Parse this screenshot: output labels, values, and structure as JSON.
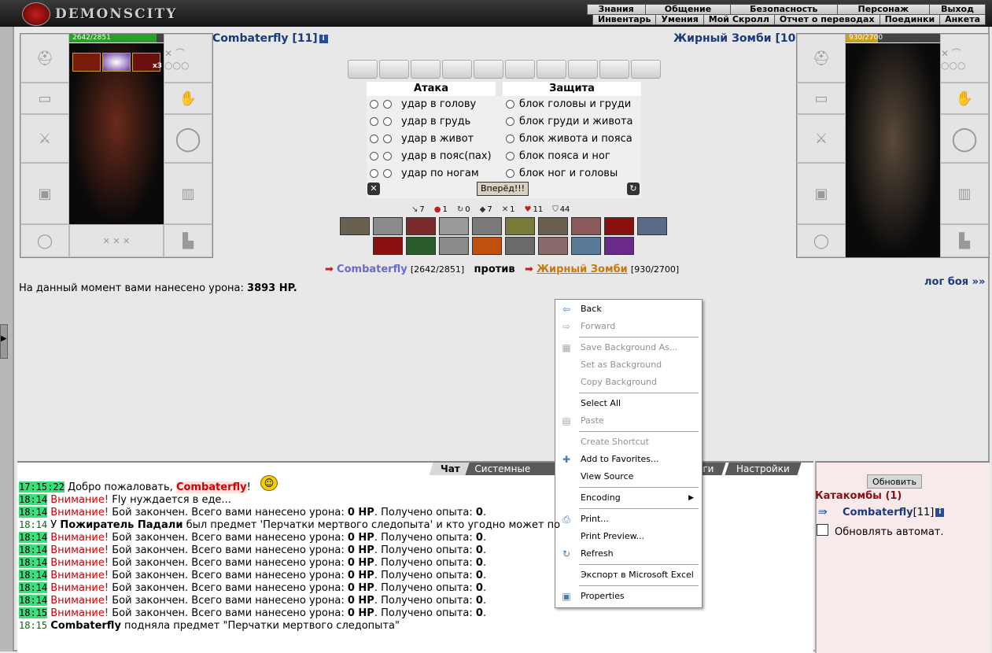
{
  "topbar": {
    "logo_text": "DEMONSCITY",
    "menu_top": [
      "Знания",
      "Общение",
      "Безопасность",
      "Персонаж",
      "Выход"
    ],
    "menu_bottom": [
      "Инвентарь",
      "Умения",
      "Мой Скролл",
      "Отчет о переводах",
      "Поединки",
      "Анкета"
    ]
  },
  "player": {
    "name": "Combaterfly [11]",
    "hp": "2642/2851",
    "hp_fraction": 0.927,
    "buff_count": "x3"
  },
  "enemy": {
    "name": "Жирный Зомби [10]",
    "hp": "930/2700",
    "hp_fraction": 0.344
  },
  "combat": {
    "attack_header": "Атака",
    "defense_header": "Защита",
    "attacks": [
      "удар в голову",
      "удар в грудь",
      "удар в живот",
      "удар в пояс(пах)",
      "удар по ногам"
    ],
    "defenses": [
      "блок головы и груди",
      "блок груди и живота",
      "блок живота и пояса",
      "блок пояса и ног",
      "блок ног и головы"
    ],
    "go_button": "Вперёд!!!",
    "stats": [
      {
        "icon": "sword-icon",
        "value": "7"
      },
      {
        "icon": "blood-icon",
        "value": "1"
      },
      {
        "icon": "counter-icon",
        "value": "0"
      },
      {
        "icon": "shield-icon",
        "value": "7"
      },
      {
        "icon": "crossed-swords-icon",
        "value": "1"
      },
      {
        "icon": "heart-icon",
        "value": "11"
      },
      {
        "icon": "armor-icon",
        "value": "44"
      }
    ]
  },
  "versus": {
    "player_name": "Combaterfly",
    "player_hp": "[2642/2851]",
    "word": "против",
    "enemy_name": "Жирный Зомби",
    "enemy_hp": "[930/2700]"
  },
  "damage": {
    "prefix": "На данный момент вами нанесено урона: ",
    "value": "3893 HP.",
    "log_link": "лог боя »»"
  },
  "chat": {
    "tabs": [
      "Чат",
      "Системные сооб",
      "оги",
      "Настройки"
    ],
    "lines": [
      {
        "time": "17:15:22",
        "hl": true,
        "parts": [
          {
            "t": "Добро пожаловать, ",
            "c": ""
          },
          {
            "t": "Combaterfly",
            "c": "nick"
          },
          {
            "t": "!",
            "c": ""
          }
        ]
      },
      {
        "time": "18:14",
        "hl": true,
        "parts": [
          {
            "t": "Внимание!",
            "c": "warn"
          },
          {
            "t": " Fly нуждается в еде...",
            "c": ""
          }
        ]
      },
      {
        "time": "18:14",
        "hl": true,
        "parts": [
          {
            "t": "Внимание!",
            "c": "warn"
          },
          {
            "t": " Бой закончен. Всего вами нанесено урона: ",
            "c": ""
          },
          {
            "t": "0 HP",
            "c": "b"
          },
          {
            "t": ". Получено опыта: ",
            "c": ""
          },
          {
            "t": "0",
            "c": "b"
          },
          {
            "t": ".",
            "c": ""
          }
        ]
      },
      {
        "time": "18:14",
        "hl": false,
        "parts": [
          {
            "t": "У ",
            "c": ""
          },
          {
            "t": "Пожиратель Падали",
            "c": "b"
          },
          {
            "t": " был предмет 'Перчатки мертвого следопыта' и кто угодно может по",
            "c": ""
          }
        ]
      },
      {
        "time": "18:14",
        "hl": true,
        "parts": [
          {
            "t": "Внимание!",
            "c": "warn"
          },
          {
            "t": " Бой закончен. Всего вами нанесено урона: ",
            "c": ""
          },
          {
            "t": "0 HP",
            "c": "b"
          },
          {
            "t": ". Получено опыта: ",
            "c": ""
          },
          {
            "t": "0",
            "c": "b"
          },
          {
            "t": ".",
            "c": ""
          }
        ]
      },
      {
        "time": "18:14",
        "hl": true,
        "parts": [
          {
            "t": "Внимание!",
            "c": "warn"
          },
          {
            "t": " Бой закончен. Всего вами нанесено урона: ",
            "c": ""
          },
          {
            "t": "0 HP",
            "c": "b"
          },
          {
            "t": ". Получено опыта: ",
            "c": ""
          },
          {
            "t": "0",
            "c": "b"
          },
          {
            "t": ".",
            "c": ""
          }
        ]
      },
      {
        "time": "18:14",
        "hl": true,
        "parts": [
          {
            "t": "Внимание!",
            "c": "warn"
          },
          {
            "t": " Бой закончен. Всего вами нанесено урона: ",
            "c": ""
          },
          {
            "t": "0 HP",
            "c": "b"
          },
          {
            "t": ". Получено опыта: ",
            "c": ""
          },
          {
            "t": "0",
            "c": "b"
          },
          {
            "t": ".",
            "c": ""
          }
        ]
      },
      {
        "time": "18:14",
        "hl": true,
        "parts": [
          {
            "t": "Внимание!",
            "c": "warn"
          },
          {
            "t": " Бой закончен. Всего вами нанесено урона: ",
            "c": ""
          },
          {
            "t": "0 HP",
            "c": "b"
          },
          {
            "t": ". Получено опыта: ",
            "c": ""
          },
          {
            "t": "0",
            "c": "b"
          },
          {
            "t": ".",
            "c": ""
          }
        ]
      },
      {
        "time": "18:14",
        "hl": true,
        "parts": [
          {
            "t": "Внимание!",
            "c": "warn"
          },
          {
            "t": " Бой закончен. Всего вами нанесено урона: ",
            "c": ""
          },
          {
            "t": "0 HP",
            "c": "b"
          },
          {
            "t": ". Получено опыта: ",
            "c": ""
          },
          {
            "t": "0",
            "c": "b"
          },
          {
            "t": ".",
            "c": ""
          }
        ]
      },
      {
        "time": "18:14",
        "hl": true,
        "parts": [
          {
            "t": "Внимание!",
            "c": "warn"
          },
          {
            "t": " Бой закончен. Всего вами нанесено урона: ",
            "c": ""
          },
          {
            "t": "0 HP",
            "c": "b"
          },
          {
            "t": ". Получено опыта: ",
            "c": ""
          },
          {
            "t": "0",
            "c": "b"
          },
          {
            "t": ".",
            "c": ""
          }
        ]
      },
      {
        "time": "18:15",
        "hl": true,
        "parts": [
          {
            "t": "Внимание!",
            "c": "warn"
          },
          {
            "t": " Бой закончен. Всего вами нанесено урона: ",
            "c": ""
          },
          {
            "t": "0 HP",
            "c": "b"
          },
          {
            "t": ". Получено опыта: ",
            "c": ""
          },
          {
            "t": "0",
            "c": "b"
          },
          {
            "t": ".",
            "c": ""
          }
        ]
      },
      {
        "time": "18:15",
        "hl": false,
        "parts": [
          {
            "t": "Combaterfly",
            "c": "b"
          },
          {
            "t": " подняла предмет \"Перчатки мертвого следопыта\"",
            "c": ""
          }
        ]
      }
    ]
  },
  "rightpanel": {
    "refresh_button": "Обновить",
    "location": "Катакомбы (1)",
    "user_name": "Combaterfly",
    "user_level": "[11]",
    "auto_refresh": "Обновлять автомат."
  },
  "context_menu": {
    "items": [
      {
        "label": "Back",
        "icon": "back-arrow-icon",
        "disabled": false
      },
      {
        "label": "Forward",
        "icon": "forward-arrow-icon",
        "disabled": true
      },
      {
        "sep": true
      },
      {
        "label": "Save Background As...",
        "icon": "save-image-icon",
        "disabled": true
      },
      {
        "label": "Set as Background",
        "icon": "",
        "disabled": true
      },
      {
        "label": "Copy Background",
        "icon": "",
        "disabled": true
      },
      {
        "sep": true
      },
      {
        "label": "Select All",
        "icon": "",
        "disabled": false
      },
      {
        "label": "Paste",
        "icon": "paste-icon",
        "disabled": true
      },
      {
        "sep": true
      },
      {
        "label": "Create Shortcut",
        "icon": "",
        "disabled": true
      },
      {
        "label": "Add to Favorites...",
        "icon": "favorites-icon",
        "disabled": false
      },
      {
        "label": "View Source",
        "icon": "",
        "disabled": false
      },
      {
        "sep": true
      },
      {
        "label": "Encoding",
        "icon": "",
        "disabled": false,
        "submenu": true
      },
      {
        "sep": true
      },
      {
        "label": "Print...",
        "icon": "print-icon",
        "disabled": false
      },
      {
        "label": "Print Preview...",
        "icon": "",
        "disabled": false
      },
      {
        "label": "Refresh",
        "icon": "refresh-icon",
        "disabled": false
      },
      {
        "sep": true
      },
      {
        "label": "Экспорт в Microsoft Excel",
        "icon": "",
        "disabled": false
      },
      {
        "sep": true
      },
      {
        "label": "Properties",
        "icon": "properties-icon",
        "disabled": false
      }
    ]
  }
}
